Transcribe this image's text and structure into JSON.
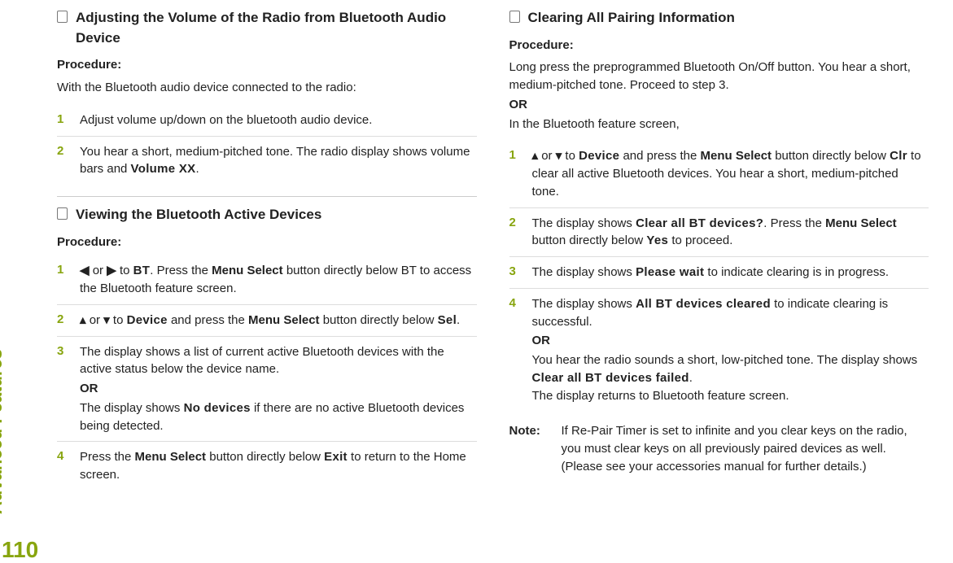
{
  "side_section": "Advanced Features",
  "page_number": "110",
  "left": {
    "sec1": {
      "title": "Adjusting the Volume of the Radio from Bluetooth Audio Device",
      "proc_label": "Procedure:",
      "intro": "With the Bluetooth audio device connected to the radio:",
      "step1": "Adjust volume up/down on the bluetooth audio device.",
      "step2_a": "You hear a short, medium-pitched tone. The radio display shows volume bars and ",
      "step2_disp": "Volume XX",
      "step2_b": "."
    },
    "sec2": {
      "title": "Viewing the Bluetooth Active Devices",
      "proc_label": "Procedure:",
      "s1_arrow_left": "◀",
      "s1_or": " or ",
      "s1_arrow_right": "▶",
      "s1_a": " to ",
      "s1_bt": "BT",
      "s1_b": ". Press the ",
      "s1_menu": "Menu Select",
      "s1_c": " button directly below BT to access the Bluetooth feature screen.",
      "s2_arrow_up": "▴",
      "s2_or": " or ",
      "s2_arrow_down": "▾",
      "s2_a": " to ",
      "s2_device": "Device",
      "s2_b": " and press the ",
      "s2_menu": "Menu Select",
      "s2_c": " button directly below ",
      "s2_sel": "Sel",
      "s2_d": ".",
      "s3_a": "The display shows a list of current active Bluetooth devices with the active status below the device name.",
      "s3_or": "OR",
      "s3_b": "The display shows ",
      "s3_nodev": "No devices",
      "s3_c": " if there are no active Bluetooth devices being detected.",
      "s4_a": "Press the ",
      "s4_menu": "Menu Select",
      "s4_b": " button directly below ",
      "s4_exit": "Exit",
      "s4_c": " to return to the Home screen."
    }
  },
  "right": {
    "sec1": {
      "title": "Clearing All Pairing Information",
      "proc_label": "Procedure:",
      "intro_a": "Long press the preprogrammed Bluetooth On/Off button. You hear a short, medium-pitched tone. Proceed to step 3.",
      "intro_or": "OR",
      "intro_b": "In the Bluetooth feature screen,",
      "s1_arrow_up": "▴",
      "s1_or": " or ",
      "s1_arrow_down": "▾",
      "s1_a": " to ",
      "s1_device": "Device",
      "s1_b": " and press the ",
      "s1_menu": "Menu Select",
      "s1_c": " button directly below ",
      "s1_clr": "Clr",
      "s1_d": " to clear all active Bluetooth devices. You hear a short, medium-pitched tone.",
      "s2_a": "The display shows ",
      "s2_clearq": "Clear all BT devices?",
      "s2_b": ". Press the ",
      "s2_menu": "Menu Select",
      "s2_c": " button directly below ",
      "s2_yes": "Yes",
      "s2_d": " to proceed.",
      "s3_a": "The display shows ",
      "s3_wait": "Please wait",
      "s3_b": " to indicate clearing is in progress.",
      "s4_a": "The display shows ",
      "s4_cleared": "All BT devices cleared",
      "s4_b": " to indicate clearing is successful.",
      "s4_or": "OR",
      "s4_c": "You hear the radio sounds a short, low-pitched tone. The display shows ",
      "s4_failed": "Clear all BT devices failed",
      "s4_d": ".",
      "s4_e": "The display returns to Bluetooth feature screen.",
      "note_label": "Note:",
      "note_body": "If Re-Pair Timer is set to infinite and you clear keys on the radio, you must clear keys on all previously paired devices as well. (Please see your accessories manual for further details.)"
    }
  }
}
